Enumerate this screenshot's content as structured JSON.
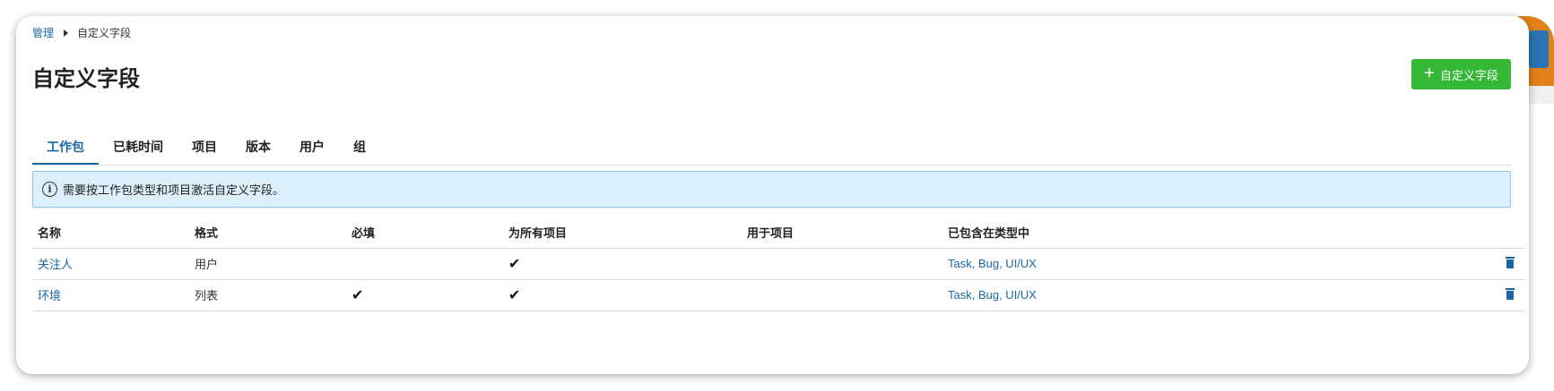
{
  "breadcrumb": {
    "parent": "管理",
    "current": "自定义字段"
  },
  "page_title": "自定义字段",
  "add_button": {
    "icon": "plus-icon",
    "label": "自定义字段",
    "color": "#35b836"
  },
  "tabs": [
    {
      "label": "工作包",
      "active": true
    },
    {
      "label": "已耗时间"
    },
    {
      "label": "项目"
    },
    {
      "label": "版本"
    },
    {
      "label": "用户"
    },
    {
      "label": "组"
    }
  ],
  "notice": {
    "icon": "info-icon",
    "text": "需要按工作包类型和项目激活自定义字段。"
  },
  "table": {
    "headers": [
      "名称",
      "格式",
      "必填",
      "为所有项目",
      "用于项目",
      "已包含在类型中"
    ],
    "rows": [
      {
        "name": "关注人",
        "format": "用户",
        "required": false,
        "for_all": true,
        "used_in": "",
        "types": "Task, Bug, UI/UX"
      },
      {
        "name": "环境",
        "format": "列表",
        "required": true,
        "for_all": true,
        "used_in": "",
        "types": "Task, Bug, UI/UX"
      }
    ]
  },
  "colors": {
    "link": "#1a67a3",
    "notice_bg": "#dbf0fb",
    "accent_green": "#35b836"
  }
}
